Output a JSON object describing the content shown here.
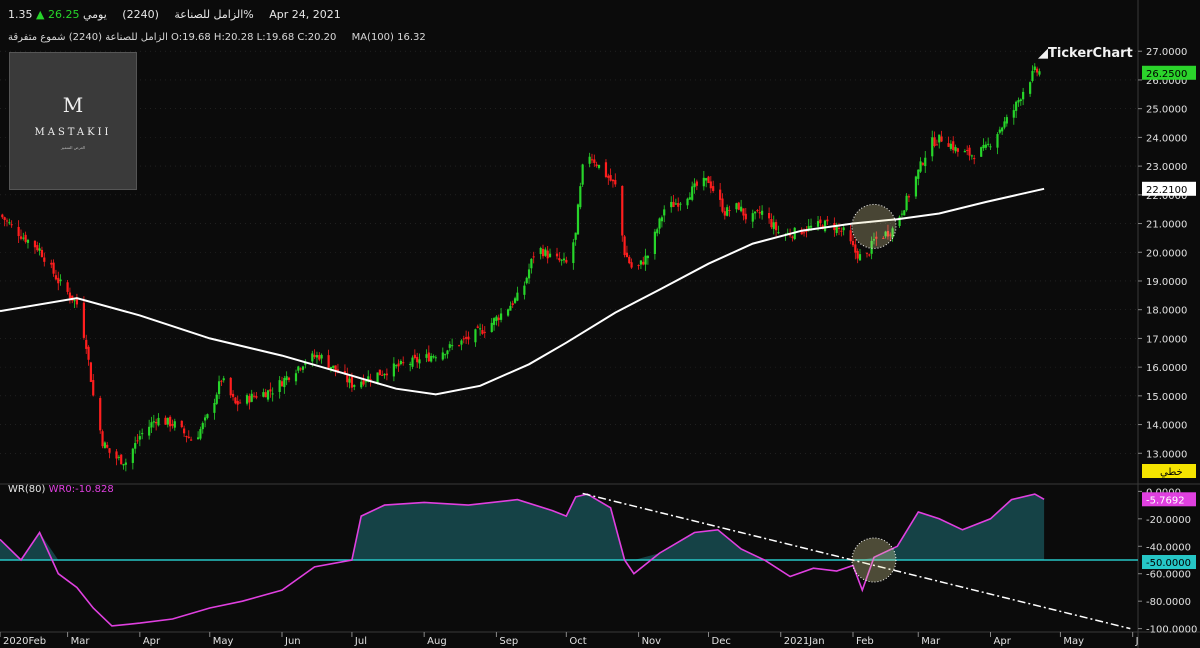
{
  "header": {
    "stock_name": "الزامل للصناعة",
    "code": "(2240)",
    "period": "يومي",
    "price": "26.25",
    "change_pct": "1.35%",
    "date": "Apr 24, 2021",
    "ohlc_line": "الزامل للصناعة (2240) شموع متفرقة",
    "open": "O:19.68",
    "high": "H:20.28",
    "low": "L:19.68",
    "close": "C:20.20",
    "ma_label": "MA(100)",
    "ma_value": "16.32"
  },
  "logo": {
    "monogram": "M",
    "name": "MASTAKII",
    "tagline": "العرض المتميز"
  },
  "brand": "TickerChart",
  "wr_header": {
    "label": "WR(80)",
    "value": "WR0:-10.828"
  },
  "colors": {
    "up": "#27d52a",
    "down": "#ff1e1e",
    "ma": "#ffffff",
    "wr": "#e040e0",
    "fill": "#16484c",
    "ref_line": "#26c6c6",
    "grid": "#2e2e2e",
    "price_tag": "#2bd42b",
    "wr_tag": "#e040e0",
    "linear_tag": "#f5e400"
  },
  "chart_data": [
    {
      "type": "candlestick",
      "ylim": [
        12.0,
        27.6
      ],
      "y_ticks": [
        "27.0000",
        "26.0000",
        "25.0000",
        "24.0000",
        "23.0000",
        "22.0000",
        "21.0000",
        "20.0000",
        "19.0000",
        "18.0000",
        "17.0000",
        "16.0000",
        "15.0000",
        "14.0000",
        "13.0000"
      ],
      "x_ticks": [
        "2020Feb",
        "Mar",
        "Apr",
        "May",
        "Jun",
        "Jul",
        "Aug",
        "Sep",
        "Oct",
        "Nov",
        "Dec",
        "2021Jan",
        "Feb",
        "Mar",
        "Apr",
        "May",
        "J"
      ],
      "last_price_label": "26.2500",
      "ma_label": "22.2100",
      "scale_label": "خطي",
      "close_path": [
        [
          "2020-02-01",
          21.3
        ],
        [
          "2020-02-10",
          20.6
        ],
        [
          "2020-02-18",
          20.1
        ],
        [
          "2020-02-26",
          19.0
        ],
        [
          "2020-03-01",
          18.6
        ],
        [
          "2020-03-05",
          18.2
        ],
        [
          "2020-03-09",
          16.8
        ],
        [
          "2020-03-12",
          15.0
        ],
        [
          "2020-03-16",
          13.4
        ],
        [
          "2020-03-20",
          12.9
        ],
        [
          "2020-03-26",
          12.7
        ],
        [
          "2020-04-01",
          13.6
        ],
        [
          "2020-04-08",
          14.2
        ],
        [
          "2020-04-16",
          14.0
        ],
        [
          "2020-04-24",
          13.4
        ],
        [
          "2020-05-01",
          14.4
        ],
        [
          "2020-05-06",
          15.6
        ],
        [
          "2020-05-12",
          14.7
        ],
        [
          "2020-05-20",
          15.0
        ],
        [
          "2020-05-28",
          15.2
        ],
        [
          "2020-06-05",
          15.8
        ],
        [
          "2020-06-12",
          16.3
        ],
        [
          "2020-06-17",
          16.4
        ],
        [
          "2020-06-24",
          15.9
        ],
        [
          "2020-07-01",
          15.4
        ],
        [
          "2020-07-10",
          15.7
        ],
        [
          "2020-07-20",
          16.0
        ],
        [
          "2020-08-01",
          16.3
        ],
        [
          "2020-08-10",
          16.6
        ],
        [
          "2020-08-20",
          17.0
        ],
        [
          "2020-08-28",
          17.4
        ],
        [
          "2020-09-05",
          18.0
        ],
        [
          "2020-09-12",
          18.6
        ],
        [
          "2020-09-18",
          20.2
        ],
        [
          "2020-09-25",
          19.8
        ],
        [
          "2020-10-01",
          19.6
        ],
        [
          "2020-10-05",
          20.6
        ],
        [
          "2020-10-06",
          21.5
        ],
        [
          "2020-10-09",
          23.6
        ],
        [
          "2020-10-15",
          23.0
        ],
        [
          "2020-10-22",
          22.3
        ],
        [
          "2020-10-26",
          20.0
        ],
        [
          "2020-10-30",
          19.3
        ],
        [
          "2020-11-05",
          19.9
        ],
        [
          "2020-11-12",
          21.5
        ],
        [
          "2020-11-19",
          21.8
        ],
        [
          "2020-11-26",
          22.3
        ],
        [
          "2020-12-01",
          22.5
        ],
        [
          "2020-12-08",
          21.4
        ],
        [
          "2020-12-14",
          21.6
        ],
        [
          "2020-12-18",
          21.1
        ],
        [
          "2020-12-24",
          21.4
        ],
        [
          "2021-01-01",
          20.6
        ],
        [
          "2021-01-08",
          20.7
        ],
        [
          "2021-01-15",
          20.9
        ],
        [
          "2021-01-22",
          21.0
        ],
        [
          "2021-01-28",
          20.7
        ],
        [
          "2021-02-02",
          20.0
        ],
        [
          "2021-02-06",
          19.7
        ],
        [
          "2021-02-10",
          20.4
        ],
        [
          "2021-02-18",
          20.8
        ],
        [
          "2021-02-24",
          21.8
        ],
        [
          "2021-03-01",
          22.8
        ],
        [
          "2021-03-06",
          23.8
        ],
        [
          "2021-03-12",
          24.0
        ],
        [
          "2021-03-18",
          23.5
        ],
        [
          "2021-03-24",
          23.4
        ],
        [
          "2021-03-30",
          23.6
        ],
        [
          "2021-04-04",
          24.2
        ],
        [
          "2021-04-10",
          24.8
        ],
        [
          "2021-04-16",
          25.8
        ],
        [
          "2021-04-20",
          26.3
        ],
        [
          "2021-04-24",
          26.25
        ]
      ],
      "ma100": [
        [
          "2020-02-01",
          17.95
        ],
        [
          "2020-03-05",
          18.4
        ],
        [
          "2020-04-01",
          17.8
        ],
        [
          "2020-05-01",
          17.0
        ],
        [
          "2020-06-01",
          16.4
        ],
        [
          "2020-07-01",
          15.7
        ],
        [
          "2020-07-20",
          15.25
        ],
        [
          "2020-08-06",
          15.05
        ],
        [
          "2020-08-25",
          15.35
        ],
        [
          "2020-09-15",
          16.1
        ],
        [
          "2020-10-01",
          16.85
        ],
        [
          "2020-10-22",
          17.9
        ],
        [
          "2020-11-10",
          18.7
        ],
        [
          "2020-12-01",
          19.6
        ],
        [
          "2020-12-20",
          20.3
        ],
        [
          "2021-01-10",
          20.75
        ],
        [
          "2021-02-01",
          21.0
        ],
        [
          "2021-02-20",
          21.15
        ],
        [
          "2021-03-10",
          21.35
        ],
        [
          "2021-03-30",
          21.75
        ],
        [
          "2021-04-24",
          22.21
        ]
      ],
      "highlight_circle": {
        "date": "2021-02-10",
        "value": 20.9
      }
    },
    {
      "type": "line",
      "indicator": "WR(80)",
      "ylim": [
        -101,
        1
      ],
      "y_ticks": [
        "0.0000",
        "-20.0000",
        "-40.0000",
        "-60.0000",
        "-80.0000",
        "-100.0000"
      ],
      "reference_level": -50,
      "reference_label": "-50.0000",
      "last_value_label": "-5.7692",
      "wr_path": [
        [
          "2020-02-01",
          -35
        ],
        [
          "2020-02-10",
          -50
        ],
        [
          "2020-02-18",
          -30
        ],
        [
          "2020-02-26",
          -60
        ],
        [
          "2020-03-05",
          -70
        ],
        [
          "2020-03-12",
          -85
        ],
        [
          "2020-03-20",
          -98
        ],
        [
          "2020-04-01",
          -96
        ],
        [
          "2020-04-15",
          -93
        ],
        [
          "2020-05-01",
          -85
        ],
        [
          "2020-05-15",
          -80
        ],
        [
          "2020-06-01",
          -72
        ],
        [
          "2020-06-15",
          -55
        ],
        [
          "2020-07-01",
          -50
        ],
        [
          "2020-07-05",
          -18
        ],
        [
          "2020-07-15",
          -10
        ],
        [
          "2020-08-01",
          -8
        ],
        [
          "2020-08-20",
          -10
        ],
        [
          "2020-09-10",
          -6
        ],
        [
          "2020-09-25",
          -14
        ],
        [
          "2020-10-01",
          -18
        ],
        [
          "2020-10-05",
          -4
        ],
        [
          "2020-10-10",
          -2
        ],
        [
          "2020-10-20",
          -12
        ],
        [
          "2020-10-26",
          -50
        ],
        [
          "2020-10-30",
          -60
        ],
        [
          "2020-11-10",
          -45
        ],
        [
          "2020-11-25",
          -30
        ],
        [
          "2020-12-05",
          -28
        ],
        [
          "2020-12-15",
          -42
        ],
        [
          "2020-12-25",
          -50
        ],
        [
          "2021-01-05",
          -62
        ],
        [
          "2021-01-15",
          -56
        ],
        [
          "2021-01-25",
          -58
        ],
        [
          "2021-02-01",
          -54
        ],
        [
          "2021-02-05",
          -72
        ],
        [
          "2021-02-10",
          -48
        ],
        [
          "2021-02-20",
          -40
        ],
        [
          "2021-03-01",
          -15
        ],
        [
          "2021-03-10",
          -20
        ],
        [
          "2021-03-20",
          -28
        ],
        [
          "2021-04-01",
          -20
        ],
        [
          "2021-04-10",
          -6
        ],
        [
          "2021-04-20",
          -2
        ],
        [
          "2021-04-24",
          -5.77
        ]
      ],
      "trendline": [
        [
          "2020-10-08",
          -1.5
        ],
        [
          "2021-05-31",
          -100
        ]
      ],
      "highlight_circle": {
        "date": "2021-02-10",
        "value": -50
      }
    }
  ]
}
